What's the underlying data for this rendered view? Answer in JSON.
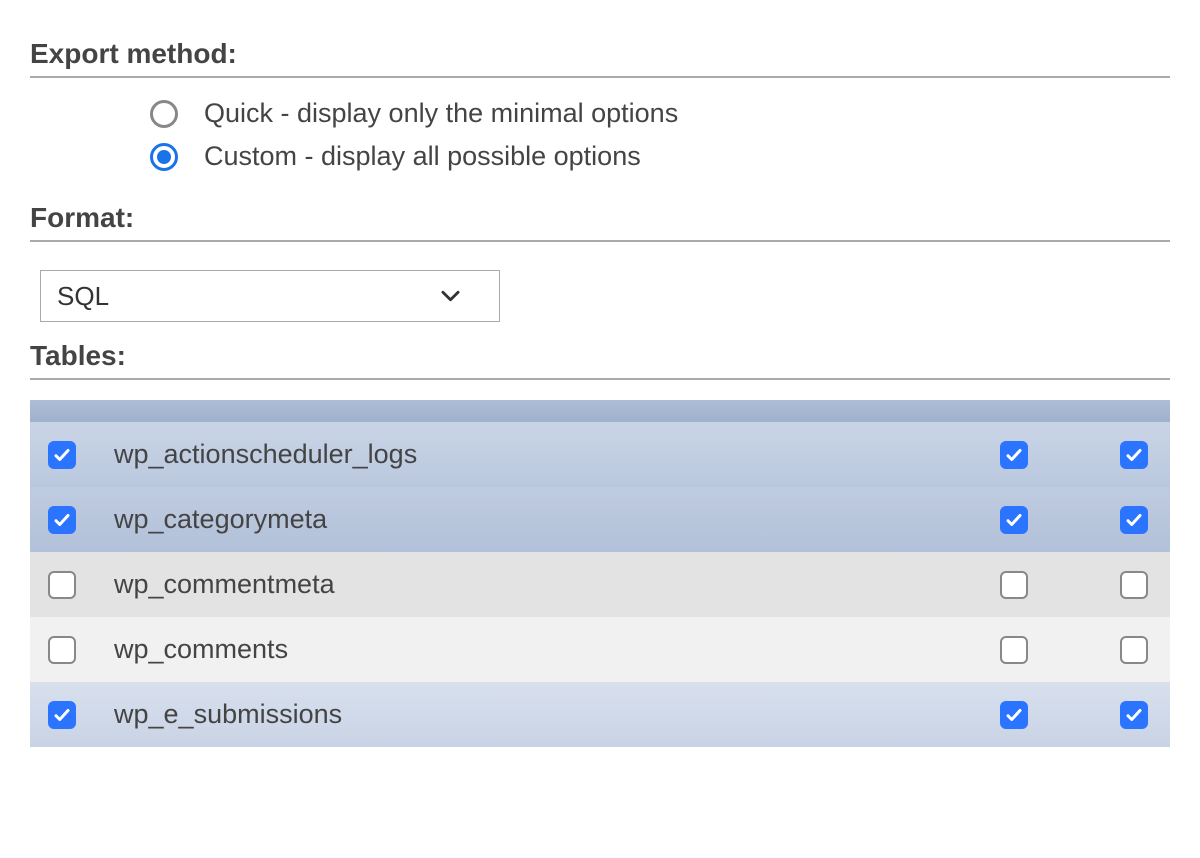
{
  "headings": {
    "export_method": "Export method:",
    "format": "Format:",
    "tables": "Tables:"
  },
  "export_method": {
    "options": [
      {
        "label": "Quick - display only the minimal options",
        "selected": false
      },
      {
        "label": "Custom - display all possible options",
        "selected": true
      }
    ]
  },
  "format": {
    "selected": "SQL"
  },
  "tables": {
    "rows": [
      {
        "name": "wp_actionscheduler_logs",
        "checked_main": true,
        "checked_a": true,
        "checked_b": true,
        "row_class": "row-sel-0"
      },
      {
        "name": "wp_categorymeta",
        "checked_main": true,
        "checked_a": true,
        "checked_b": true,
        "row_class": "row-sel-1"
      },
      {
        "name": "wp_commentmeta",
        "checked_main": false,
        "checked_a": false,
        "checked_b": false,
        "row_class": "row-unsel-0"
      },
      {
        "name": "wp_comments",
        "checked_main": false,
        "checked_a": false,
        "checked_b": false,
        "row_class": "row-unsel-1"
      },
      {
        "name": "wp_e_submissions",
        "checked_main": true,
        "checked_a": true,
        "checked_b": true,
        "row_class": "row-sel-end"
      }
    ]
  }
}
